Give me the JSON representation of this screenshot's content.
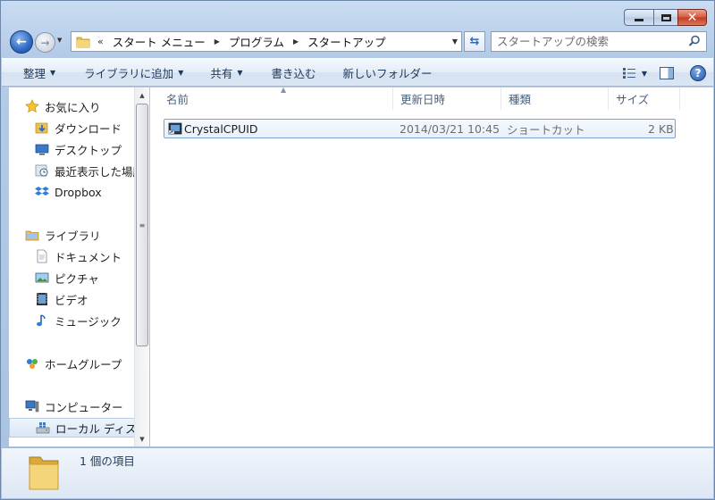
{
  "window": {
    "caption_buttons": {
      "minimize": "minimize-icon",
      "maximize": "maximize-icon",
      "close": "close-icon"
    }
  },
  "address_bar": {
    "chevron": "«",
    "crumbs": [
      "スタート メニュー",
      "プログラム",
      "スタートアップ"
    ]
  },
  "search": {
    "placeholder": "スタートアップの検索"
  },
  "commands": {
    "organize": "整理",
    "add_to_library": "ライブラリに追加",
    "share": "共有",
    "burn": "書き込む",
    "new_folder": "新しいフォルダー"
  },
  "nav_pane": {
    "favorites": {
      "label": "お気に入り",
      "items": [
        "ダウンロード",
        "デスクトップ",
        "最近表示した場所",
        "Dropbox"
      ]
    },
    "libraries": {
      "label": "ライブラリ",
      "items": [
        "ドキュメント",
        "ピクチャ",
        "ビデオ",
        "ミュージック"
      ]
    },
    "homegroup": {
      "label": "ホームグループ"
    },
    "computer": {
      "label": "コンピューター",
      "items": [
        "ローカル ディスク"
      ]
    }
  },
  "columns": {
    "name": "名前",
    "date": "更新日時",
    "type": "種類",
    "size": "サイズ"
  },
  "files": [
    {
      "name": "CrystalCPUID",
      "date": "2014/03/21 10:45",
      "type": "ショートカット",
      "size": "2 KB"
    }
  ],
  "status": {
    "count_text": "1 個の項目"
  },
  "colors": {
    "accent": "#2d6ac4",
    "selection_border": "#7da2ce",
    "header_text": "#4c607a",
    "close_button": "#c13b1d"
  }
}
